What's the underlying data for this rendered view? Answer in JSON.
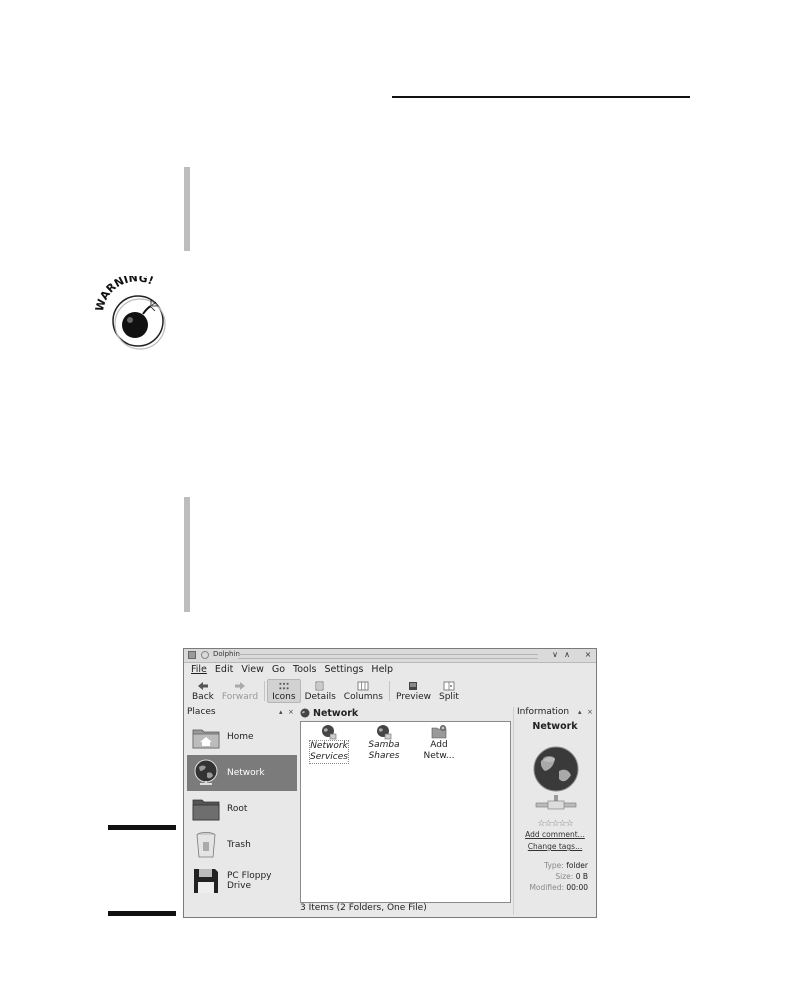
{
  "window": {
    "title": "Dolphin",
    "controls": [
      "∨",
      "∧",
      "×"
    ]
  },
  "menu": [
    "File",
    "Edit",
    "View",
    "Go",
    "Tools",
    "Settings",
    "Help"
  ],
  "toolbar": {
    "back": "Back",
    "forward": "Forward",
    "icons": "Icons",
    "details": "Details",
    "columns": "Columns",
    "preview": "Preview",
    "split": "Split"
  },
  "places": {
    "title": "Places",
    "controls": [
      "▴",
      "×"
    ],
    "items": [
      "Home",
      "Network",
      "Root",
      "Trash",
      "PC Floppy Drive"
    ]
  },
  "location": "Network",
  "files": [
    {
      "line1": "Network",
      "line2": "Services"
    },
    {
      "line1": "Samba",
      "line2": "Shares"
    },
    {
      "line1": "Add",
      "line2": "Netw..."
    }
  ],
  "status": "3 Items (2 Folders, One File)",
  "information": {
    "title": "Information",
    "controls": [
      "▴",
      "×"
    ],
    "name": "Network",
    "stars": "☆☆☆☆☆",
    "add_comment": "Add comment...",
    "change_tags": "Change tags...",
    "type_label": "Type:",
    "type_value": "folder",
    "size_label": "Size:",
    "size_value": "0 B",
    "modified_label": "Modified:",
    "modified_value": "00:00"
  },
  "warning_icon": {
    "label": "WARNING!"
  }
}
